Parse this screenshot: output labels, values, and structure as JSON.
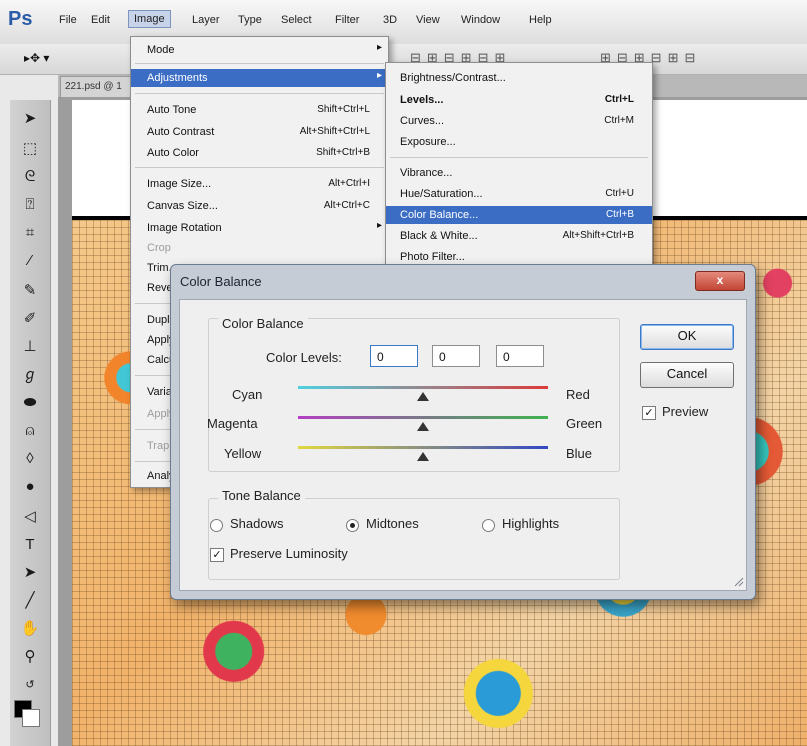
{
  "app": {
    "logo": "Ps"
  },
  "menubar": [
    "File",
    "Edit",
    "Image",
    "Layer",
    "Type",
    "Select",
    "Filter",
    "3D",
    "View",
    "Window",
    "Help"
  ],
  "doc_tab": "221.psd @ 1",
  "image_menu": {
    "items": [
      {
        "label": "Mode",
        "shortcut": "",
        "arrow": "▸"
      },
      {
        "label": "Adjustments",
        "shortcut": "",
        "arrow": "▸"
      },
      {
        "label": "Auto Tone",
        "shortcut": "Shift+Ctrl+L",
        "arrow": ""
      },
      {
        "label": "Auto Contrast",
        "shortcut": "Alt+Shift+Ctrl+L",
        "arrow": ""
      },
      {
        "label": "Auto Color",
        "shortcut": "Shift+Ctrl+B",
        "arrow": ""
      },
      {
        "label": "Image Size...",
        "shortcut": "Alt+Ctrl+I",
        "arrow": ""
      },
      {
        "label": "Canvas Size...",
        "shortcut": "Alt+Ctrl+C",
        "arrow": ""
      },
      {
        "label": "Image Rotation",
        "shortcut": "",
        "arrow": "▸"
      },
      {
        "label": "Crop",
        "shortcut": "",
        "arrow": ""
      },
      {
        "label": "Trim...",
        "shortcut": "",
        "arrow": ""
      },
      {
        "label": "Reveal All",
        "shortcut": "",
        "arrow": ""
      },
      {
        "label": "Duplicate...",
        "shortcut": "",
        "arrow": ""
      },
      {
        "label": "Apply Image...",
        "shortcut": "",
        "arrow": ""
      },
      {
        "label": "Calculations...",
        "shortcut": "",
        "arrow": ""
      },
      {
        "label": "Variables",
        "shortcut": "",
        "arrow": "▸"
      },
      {
        "label": "Apply Data Set...",
        "shortcut": "",
        "arrow": ""
      },
      {
        "label": "Trap...",
        "shortcut": "",
        "arrow": ""
      },
      {
        "label": "Analysis",
        "shortcut": "",
        "arrow": "▸"
      }
    ]
  },
  "adjustments_menu": {
    "items": [
      {
        "label": "Brightness/Contrast...",
        "shortcut": ""
      },
      {
        "label": "Levels...",
        "shortcut": "Ctrl+L"
      },
      {
        "label": "Curves...",
        "shortcut": "Ctrl+M"
      },
      {
        "label": "Exposure...",
        "shortcut": ""
      },
      {
        "label": "Vibrance...",
        "shortcut": ""
      },
      {
        "label": "Hue/Saturation...",
        "shortcut": "Ctrl+U"
      },
      {
        "label": "Color Balance...",
        "shortcut": "Ctrl+B"
      },
      {
        "label": "Black & White...",
        "shortcut": "Alt+Shift+Ctrl+B"
      },
      {
        "label": "Photo Filter...",
        "shortcut": ""
      }
    ]
  },
  "dialog": {
    "title": "Color Balance",
    "close": "x",
    "color_balance_group": "Color Balance",
    "color_levels_label": "Color Levels:",
    "levels": [
      "0",
      "0",
      "0"
    ],
    "sliders": [
      {
        "left": "Cyan",
        "right": "Red",
        "value": 0
      },
      {
        "left": "Magenta",
        "right": "Green",
        "value": 0
      },
      {
        "left": "Yellow",
        "right": "Blue",
        "value": 0
      }
    ],
    "tone_balance_group": "Tone Balance",
    "tones": [
      "Shadows",
      "Midtones",
      "Highlights"
    ],
    "selected_tone": "Midtones",
    "preserve_luminosity": "Preserve Luminosity",
    "preserve_checked": true,
    "ok": "OK",
    "cancel": "Cancel",
    "preview": "Preview",
    "preview_checked": true
  }
}
